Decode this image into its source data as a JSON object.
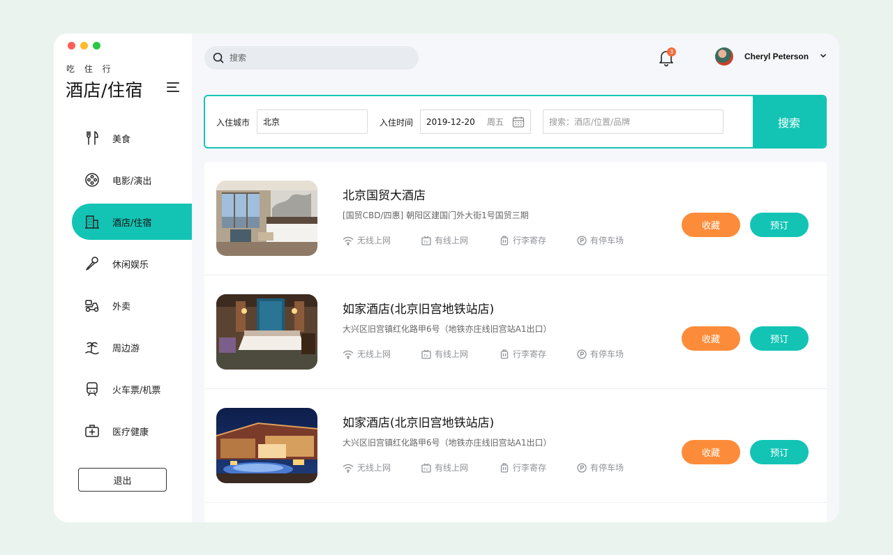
{
  "colors": {
    "accent": "#13c4b5",
    "orange": "#fd8c3a",
    "badge": "#f26d3d",
    "bg": "#ebf3ef"
  },
  "sidebar": {
    "brand_sub": "吃 住 行",
    "brand_title": "酒店/住宿",
    "items": [
      {
        "label": "美食",
        "icon": "utensils-icon"
      },
      {
        "label": "电影/演出",
        "icon": "film-reel-icon"
      },
      {
        "label": "酒店/住宿",
        "icon": "building-icon",
        "active": true
      },
      {
        "label": "休闲娱乐",
        "icon": "microphone-icon"
      },
      {
        "label": "外卖",
        "icon": "scooter-icon"
      },
      {
        "label": "周边游",
        "icon": "island-icon"
      },
      {
        "label": "火车票/机票",
        "icon": "train-icon"
      },
      {
        "label": "医疗健康",
        "icon": "medkit-icon"
      }
    ],
    "logout_label": "退出"
  },
  "header": {
    "search_placeholder": "搜索",
    "notification_count": "3",
    "user_name": "Cheryl Peterson"
  },
  "filter": {
    "city_label": "入住城市",
    "city_value": "北京",
    "date_label": "入住时间",
    "date_value": "2019-12-20",
    "weekday": "周五",
    "keyword_placeholder": "搜索：酒店/位置/品牌",
    "search_button": "搜索"
  },
  "amenities": [
    "无线上网",
    "有线上网",
    "行李寄存",
    "有停车场"
  ],
  "hotels": [
    {
      "name": "北京国贸大酒店",
      "address": "[国贸CBD/四惠] 朝阳区建国门外大街1号国贸三期",
      "fav_label": "收藏",
      "book_label": "预订"
    },
    {
      "name": "如家酒店(北京旧宫地铁站店)",
      "address": "大兴区旧宫镇红化路甲6号（地铁亦庄线旧宫站A1出口）",
      "fav_label": "收藏",
      "book_label": "预订"
    },
    {
      "name": "如家酒店(北京旧宫地铁站店)",
      "address": "大兴区旧宫镇红化路甲6号（地铁亦庄线旧宫站A1出口）",
      "fav_label": "收藏",
      "book_label": "预订"
    }
  ]
}
